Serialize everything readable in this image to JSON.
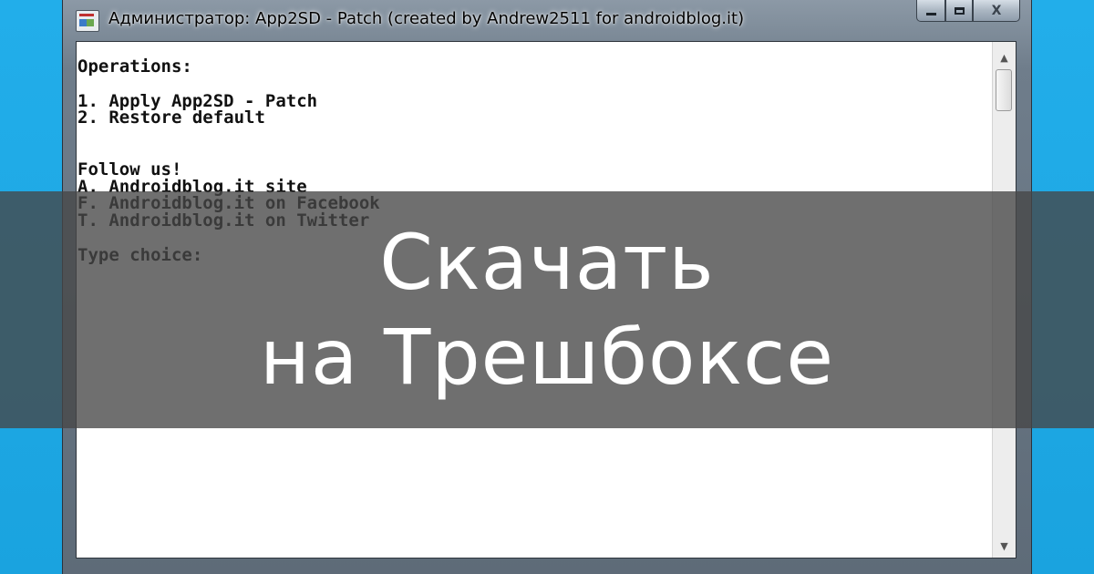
{
  "window": {
    "title": "Администратор:  App2SD - Patch (created by Andrew2511 for androidblog.it)",
    "app_icon": "console-app-icon",
    "buttons": {
      "minimize": "minimize-icon",
      "maximize": "maximize-icon",
      "close_label": "X"
    }
  },
  "console": {
    "lines": [
      "Operations:",
      "",
      "1. Apply App2SD - Patch",
      "2. Restore default",
      "",
      "",
      "Follow us!",
      "A. Androidblog.it site",
      "F. Androidblog.it on Facebook",
      "T. Androidblog.it on Twitter",
      "",
      "Type choice:"
    ]
  },
  "scrollbar": {
    "up_arrow": "▲",
    "down_arrow": "▼"
  },
  "overlay": {
    "line1": "Скачать",
    "line2": "на Трешбоксе"
  },
  "colors": {
    "background": "#1fa8e6",
    "overlay": "#4a4a4a",
    "console_bg": "#ffffff",
    "console_text": "#111111"
  }
}
